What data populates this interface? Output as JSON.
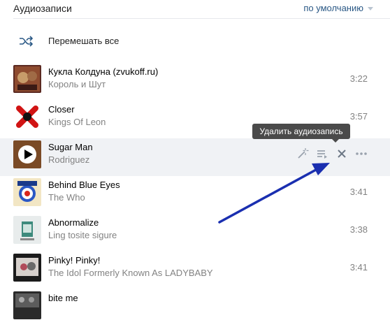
{
  "header": {
    "title": "Аудиозаписи",
    "sort_label": "по умолчанию"
  },
  "shuffle": {
    "label": "Перемешать все"
  },
  "tracks": [
    {
      "title": "Кукла Колдуна (zvukoff.ru)",
      "artist": "Король и Шут",
      "duration": "3:22"
    },
    {
      "title": "Closer",
      "artist": "Kings Of Leon",
      "duration": "3:57"
    },
    {
      "title": "Sugar Man",
      "artist": "Rodriguez",
      "duration": ""
    },
    {
      "title": "Behind Blue Eyes",
      "artist": "The Who",
      "duration": "3:41"
    },
    {
      "title": "Abnormalize",
      "artist": "Ling tosite sigure",
      "duration": "3:38"
    },
    {
      "title": "Pinky! Pinky!",
      "artist": "The Idol Formerly Known As LADYBABY",
      "duration": "3:41"
    },
    {
      "title": "bite me",
      "artist": "",
      "duration": ""
    }
  ],
  "tooltip": {
    "text": "Удалить аудиозапись"
  },
  "colors": {
    "accent": "#2a5885",
    "secondary_text": "#828282",
    "active_row": "#f0f2f5",
    "annotation_arrow": "#1a2fb0"
  }
}
